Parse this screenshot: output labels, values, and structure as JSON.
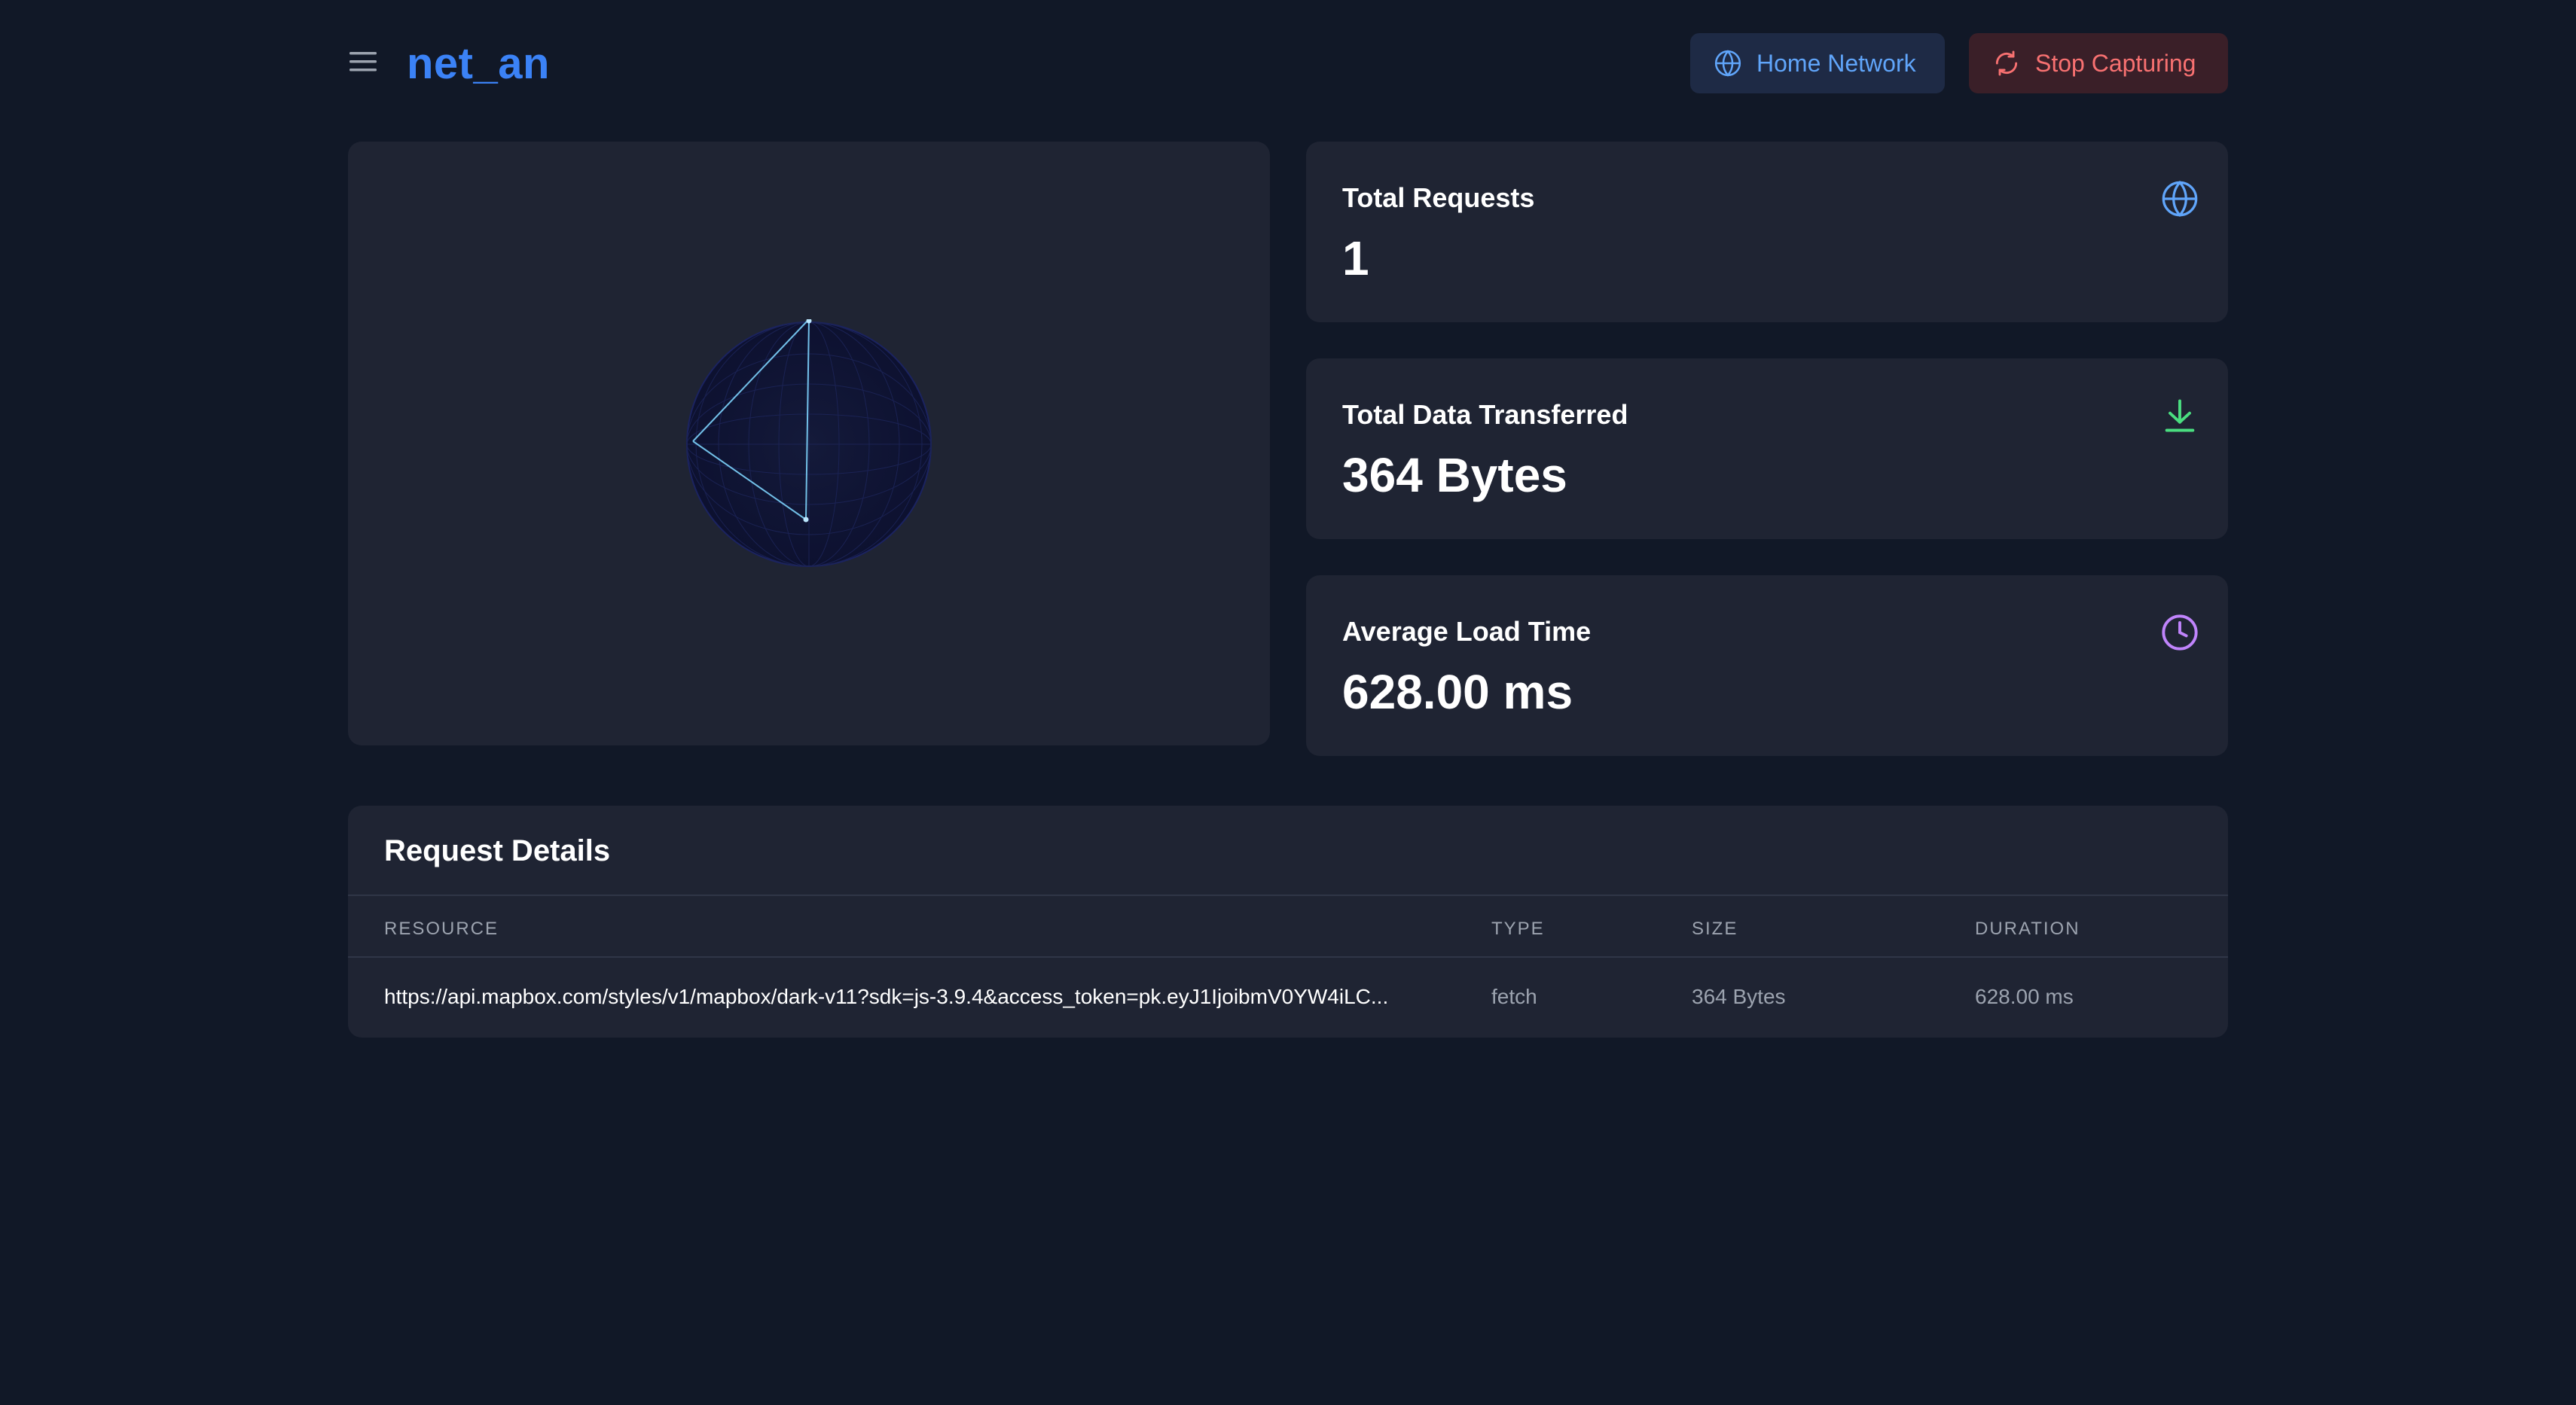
{
  "header": {
    "app_title": "net_an",
    "network_button_label": "Home Network",
    "stop_button_label": "Stop Capturing"
  },
  "colors": {
    "background": "#111827",
    "card": "#1f2433",
    "accent_blue": "#3b82f6",
    "stop_red": "#f87171",
    "download_green": "#4ade80",
    "clock_purple": "#c084fc"
  },
  "stats": [
    {
      "label": "Total Requests",
      "value": "1",
      "icon": "globe-icon"
    },
    {
      "label": "Total Data Transferred",
      "value": "364 Bytes",
      "icon": "download-icon"
    },
    {
      "label": "Average Load Time",
      "value": "628.00 ms",
      "icon": "clock-icon"
    }
  ],
  "request_table": {
    "title": "Request Details",
    "headers": [
      "RESOURCE",
      "TYPE",
      "SIZE",
      "DURATION"
    ],
    "rows": [
      {
        "resource": "https://api.mapbox.com/styles/v1/mapbox/dark-v11?sdk=js-3.9.4&access_token=pk.eyJ1IjoibmV0YW4iLC...",
        "type": "fetch",
        "size": "364 Bytes",
        "duration": "628.00 ms"
      }
    ]
  }
}
